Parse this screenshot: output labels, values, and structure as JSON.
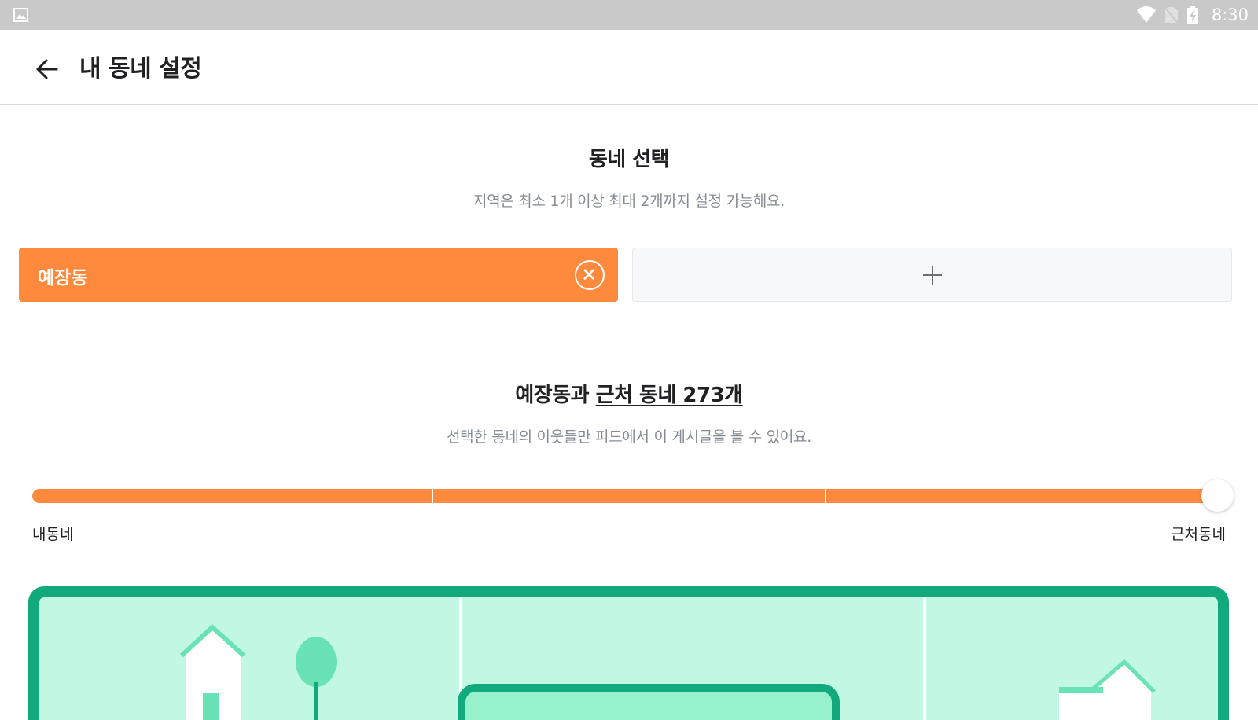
{
  "status_bar": {
    "time": "8:30",
    "icons": [
      "gallery-icon",
      "wifi-icon",
      "no-sim-icon",
      "battery-charging-icon"
    ]
  },
  "app_bar": {
    "back_icon": "arrow-left-icon",
    "title": "내 동네 설정"
  },
  "neighborhood_select": {
    "title": "동네 선택",
    "subtitle": "지역은 최소 1개 이상 최대 2개까지 설정 가능해요.",
    "selected": {
      "label": "예장동",
      "remove_icon": "close-circle-icon"
    },
    "add_icon": "plus-icon"
  },
  "range": {
    "title_prefix": "예장동과",
    "title_link": "근처 동네 273개",
    "subtitle": "선택한 동네의 이웃들만 피드에서 이 게시글을 볼 수 있어요.",
    "slider": {
      "steps": 4,
      "selected_step": 4,
      "min_label": "내동네",
      "max_label": "근처동네"
    }
  },
  "colors": {
    "accent": "#ff8a3d",
    "illustration_border": "#12a97c",
    "illustration_fill": "#c2f8e3",
    "status_bar": "#c9c9c9"
  }
}
